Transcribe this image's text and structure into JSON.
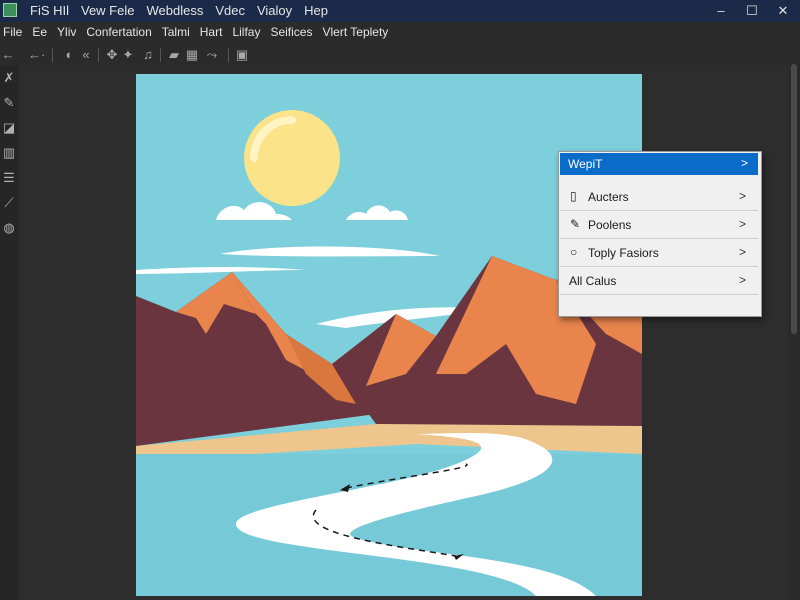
{
  "window": {
    "menu": [
      "FiS HIl",
      "Vew Fele",
      "Webdless",
      "Vdec",
      "Vialoy",
      "Hep"
    ],
    "controls": {
      "minimize": "–",
      "maximize": "☐",
      "close": "✕"
    }
  },
  "menubar": {
    "items": [
      "File",
      "Ee",
      "Yliv",
      "Confertation",
      "Talmi",
      "Hart",
      "Lilfay",
      "Seifices",
      "Vlert Teplety"
    ]
  },
  "toolbar": {
    "icons": [
      "back-arrow-icon",
      "forward-arrow-icon",
      "brush-icon",
      "arrow-back-icon",
      "move-icon",
      "sound-icon",
      "comment-icon",
      "edit-icon",
      "run-icon",
      "grid-icon"
    ]
  },
  "left_tools": {
    "icons": [
      "figure-icon",
      "pen-icon",
      "shapes-icon",
      "bars-icon",
      "stack-icon",
      "eyedropper-icon",
      "globe-icon"
    ]
  },
  "popup": {
    "header": {
      "label": "WepiT",
      "chevron": ">"
    },
    "rows": [
      {
        "icon": "▯",
        "label": "Aucters",
        "chevron": ">"
      },
      {
        "icon": "✎",
        "label": "Poolens",
        "chevron": ">"
      },
      {
        "icon": "○",
        "label": "Toply Fasiors",
        "chevron": ">"
      },
      {
        "icon": "",
        "label": "All Calus",
        "chevron": ">"
      }
    ]
  },
  "colors": {
    "sky": "#7ccfdb",
    "sun": "#fbe38a",
    "mountain_dark": "#6b3540",
    "mountain_light": "#e8844c",
    "sand": "#efc58e",
    "water": "#76cad8",
    "accent": "#0b6bc9"
  }
}
